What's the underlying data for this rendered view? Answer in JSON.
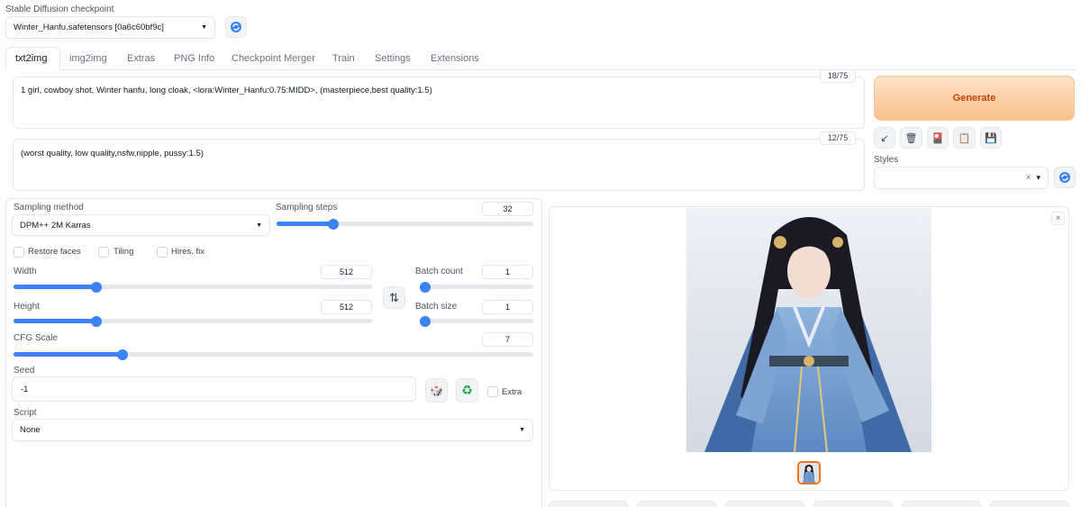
{
  "checkpoint": {
    "label": "Stable Diffusion checkpoint",
    "value": "Winter_Hanfu.safetensors [0a6c60bf9c]",
    "refresh_icon": "refresh-icon"
  },
  "tabs": [
    {
      "label": "txt2img",
      "active": true
    },
    {
      "label": "img2img"
    },
    {
      "label": "Extras"
    },
    {
      "label": "PNG Info"
    },
    {
      "label": "Checkpoint Merger"
    },
    {
      "label": "Train"
    },
    {
      "label": "Settings"
    },
    {
      "label": "Extensions"
    }
  ],
  "prompt": {
    "value": "1 girl, cowboy shot, Winter hanfu, long cloak, <lora:Winter_Hanfu:0.75:MIDD>, (masterpiece,best quality:1.5)",
    "token_counter": "18/75"
  },
  "negative_prompt": {
    "value": "(worst quality, low quality,nsfw,nipple, pussy:1.5)",
    "token_counter": "12/75"
  },
  "generate": {
    "label": "Generate",
    "color": "#f5a55c"
  },
  "tool_icons": [
    "arrow-down-left-icon",
    "trash-icon",
    "red-card-icon",
    "clipboard-icon",
    "save-icon"
  ],
  "tool_glyphs": [
    "↙",
    "🗑",
    "🎴",
    "📋",
    "💾"
  ],
  "styles": {
    "label": "Styles",
    "value": "",
    "clear": "×",
    "arrow": "▾"
  },
  "sampling": {
    "method_label": "Sampling method",
    "method_value": "DPM++ 2M Karras",
    "steps_label": "Sampling steps",
    "steps_value": "32",
    "steps_fraction": 0.22
  },
  "checkboxes": {
    "restore_faces": "Restore faces",
    "tiling": "Tiling",
    "hires_fix": "Hires. fix"
  },
  "width": {
    "label": "Width",
    "value": "512",
    "fraction": 0.23
  },
  "height": {
    "label": "Height",
    "value": "512",
    "fraction": 0.23
  },
  "swap_glyph": "⇅",
  "batch_count": {
    "label": "Batch count",
    "value": "1",
    "fraction": 0.0
  },
  "batch_size": {
    "label": "Batch size",
    "value": "1",
    "fraction": 0.0
  },
  "cfg": {
    "label": "CFG Scale",
    "value": "7",
    "fraction": 0.21
  },
  "seed": {
    "label": "Seed",
    "value": "-1",
    "dice_glyph": "🎲",
    "recycle_glyph": "♻",
    "extra_label": "Extra"
  },
  "script": {
    "label": "Script",
    "value": "None"
  },
  "output": {
    "close_glyph": "×",
    "image_desc": "girl in blue hanfu"
  },
  "colors": {
    "accent": "#3b82f6",
    "generate": "#f5a55c",
    "thumb_border": "#f97316"
  }
}
